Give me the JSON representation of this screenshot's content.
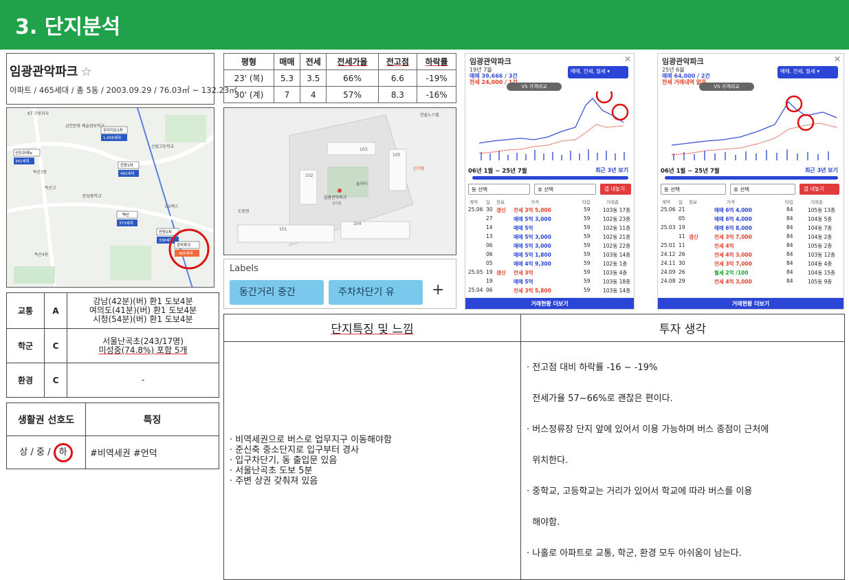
{
  "header": {
    "title": "3. 단지분석"
  },
  "complex": {
    "name": "임광관악파크",
    "star": "☆",
    "info": "아파트 / 465세대 / 총 5동 / 2003.09.29 / 76.03㎡ ~ 132.23㎡"
  },
  "price_table": {
    "headers": [
      "평형",
      "매매",
      "전세",
      "전세가율",
      "전고점",
      "하락률"
    ],
    "rows": [
      [
        "23' (복)",
        "5.3",
        "3.5",
        "66%",
        "6.6",
        "-19%"
      ],
      [
        "30' (계)",
        "7",
        "4",
        "57%",
        "8.3",
        "-16%"
      ]
    ]
  },
  "map1": {
    "labels": [
      "KT 구로지사",
      "금천문화 예술정보학교",
      "우리지오1차",
      "1,456세대",
      "신도브래뉴",
      "341세대",
      "독산3동",
      "독산고",
      "진양1차",
      "492세대",
      "벽산",
      "373세대",
      "진양2차",
      "338세대",
      "관악파크",
      "465세대",
      "현대모빌렉스",
      "독산4동",
      "관악산 벽산블루밍",
      "신림고등학교",
      "독산1동",
      "문성중학교",
      "GS렉스",
      "숭실대"
    ],
    "cursor_label": "관악파크",
    "cursor_sub": "465세대"
  },
  "map2": {
    "labels": [
      "103",
      "102",
      "101",
      "104",
      "105",
      "놀이터",
      "임광관악파크",
      "관리동",
      "도원정",
      "서울맘",
      "산기둥",
      "한솔노스텔"
    ],
    "center_label": "임광관악파크",
    "center_sub": "관리동"
  },
  "labels_panel": {
    "title": "Labels",
    "chips": [
      "동간거리 중간",
      "주차차단기 유"
    ],
    "add": "+"
  },
  "phone1": {
    "title": "임광관악파크",
    "close": "✕",
    "date": "19년 7월",
    "sale": "매매 39,666 / 3건",
    "jeonse": "전세 24,000 / 1건",
    "selector": "매매, 전세, 월세 ▾",
    "vs": "VS 가격비교",
    "range": "06년 1월 ~ 25년 7월",
    "recent": "최근 3년 보기",
    "dd1": "동 선택",
    "dd2": "호 선택",
    "btn": "갭 내놓기",
    "thead": [
      "계약",
      "일",
      "정보",
      "가격",
      "타입",
      "거래층"
    ],
    "rows": [
      {
        "ym": "25.06",
        "d": "30",
        "info": "갱신",
        "type": "red",
        "price": "전세 3억 5,000",
        "sz": "59",
        "fl": "103동 17층"
      },
      {
        "ym": "",
        "d": "27",
        "info": "",
        "type": "blue",
        "price": "매매 5억 3,000",
        "sz": "59",
        "fl": "102동 23층"
      },
      {
        "ym": "",
        "d": "14",
        "info": "",
        "type": "blue",
        "price": "매매 5억",
        "sz": "59",
        "fl": "102동 11층"
      },
      {
        "ym": "",
        "d": "13",
        "info": "",
        "type": "blue",
        "price": "매매 5억 3,000",
        "sz": "59",
        "fl": "102동 21층"
      },
      {
        "ym": "",
        "d": "06",
        "info": "",
        "type": "blue",
        "price": "매매 5억 3,000",
        "sz": "59",
        "fl": "102동 22층"
      },
      {
        "ym": "",
        "d": "06",
        "info": "",
        "type": "blue",
        "price": "매매 5억 1,800",
        "sz": "59",
        "fl": "103동 14층"
      },
      {
        "ym": "",
        "d": "05",
        "info": "",
        "type": "blue",
        "price": "매매 4억 9,300",
        "sz": "59",
        "fl": "102동 1층"
      },
      {
        "ym": "25.05",
        "d": "19",
        "info": "갱신",
        "type": "red",
        "price": "전세 3억",
        "sz": "59",
        "fl": "103동 4층"
      },
      {
        "ym": "",
        "d": "19",
        "info": "",
        "type": "blue",
        "price": "매매 5억",
        "sz": "59",
        "fl": "103동 18층"
      },
      {
        "ym": "25.04",
        "d": "06",
        "info": "",
        "type": "red",
        "price": "전세 3억 5,800",
        "sz": "59",
        "fl": "103동 14층"
      }
    ],
    "more": "거래현황 더보기"
  },
  "phone2": {
    "title": "임광관악파크",
    "close": "✕",
    "date": "25년 6월",
    "sale": "매매 64,000 / 2건",
    "jeonse": "전세 거래내역 없음",
    "selector": "매매, 전세, 월세 ▾",
    "vs": "VS 가격비교",
    "range": "06년 1월 ~ 25년 7월",
    "recent": "최근 3년 보기",
    "dd1": "동 선택",
    "dd2": "호 선택",
    "btn": "갭 내놓기",
    "thead": [
      "계약",
      "일",
      "정보",
      "가격",
      "타입",
      "거래층"
    ],
    "rows": [
      {
        "ym": "25.06",
        "d": "21",
        "info": "",
        "type": "blue",
        "price": "매매 6억 4,000",
        "sz": "84",
        "fl": "105동 13층"
      },
      {
        "ym": "",
        "d": "05",
        "info": "",
        "type": "blue",
        "price": "매매 6억 4,000",
        "sz": "84",
        "fl": "104동 5층"
      },
      {
        "ym": "25.03",
        "d": "19",
        "info": "",
        "type": "blue",
        "price": "매매 6억 8,000",
        "sz": "84",
        "fl": "104동 7층"
      },
      {
        "ym": "",
        "d": "11",
        "info": "갱신",
        "type": "red",
        "price": "전세 3억 7,000",
        "sz": "84",
        "fl": "104동 2층"
      },
      {
        "ym": "25.01",
        "d": "11",
        "info": "",
        "type": "red",
        "price": "전세 4억",
        "sz": "84",
        "fl": "105동 2층"
      },
      {
        "ym": "24.12",
        "d": "26",
        "info": "",
        "type": "red",
        "price": "전세 4억 3,000",
        "sz": "84",
        "fl": "103동 12층"
      },
      {
        "ym": "24.11",
        "d": "30",
        "info": "",
        "type": "red",
        "price": "전세 3억 7,000",
        "sz": "84",
        "fl": "104동 4층"
      },
      {
        "ym": "24.09",
        "d": "26",
        "info": "",
        "type": "green",
        "price": "월세 2억 /100",
        "sz": "84",
        "fl": "104동 15층"
      },
      {
        "ym": "24.08",
        "d": "29",
        "info": "",
        "type": "red",
        "price": "전세 4억 3,000",
        "sz": "84",
        "fl": "105동 9층"
      }
    ],
    "more": "거래현황 더보기"
  },
  "left_table": {
    "rows": [
      {
        "label": "교통",
        "grade": "A",
        "desc": [
          "강남(42분)(버) 환1 도보4분",
          "여의도(41분)(버) 환1 도보4분",
          "시청(54분)(버) 환1 도보4분"
        ]
      },
      {
        "label": "학군",
        "grade": "C",
        "desc": [
          "서울난곡초(243/17명)",
          "미성중(74.8%) 포함 5개"
        ]
      },
      {
        "label": "환경",
        "grade": "C",
        "desc": [
          "-"
        ]
      }
    ]
  },
  "pref_table": {
    "h1": "생활권 선호도",
    "h2": "특징",
    "pref_prefix": "상 / 중 /",
    "pref_selected": "하",
    "feature": "#비역세권 #언덕"
  },
  "bottom": {
    "left_title": "단지특징 및 느낌",
    "right_title": "투자 생각",
    "left_items": [
      "· 비역세권으로 버스로 업무지구 이동해야함",
      "· 준신축 중소단지로 입구부터 경사",
      "· 입구차단기, 동 출입문 있음",
      "· 서울난곡초 도보 5분",
      "· 주변 상권 갖춰져 있음"
    ],
    "right_items": [
      "· 전고점 대비 하락률 -16 ~ -19%",
      "  전세가율 57~66%로 괜찮은 편이다.",
      "· 버스정류장 단지 앞에 있어서 이용 가능하며 버스 종점이 근처에",
      "  위치한다.",
      "· 중학교, 고등학교는 거리가 있어서 학교에 따라 버스를 이용",
      "  해야함.",
      "· 나홀로 아파트로 교통, 학군, 환경 모두 아쉬움이 남는다."
    ]
  },
  "colors": {
    "header": "#20a24a",
    "sale": "#2b45d6",
    "jeonse": "#e2402a",
    "circle": "#d11111"
  }
}
